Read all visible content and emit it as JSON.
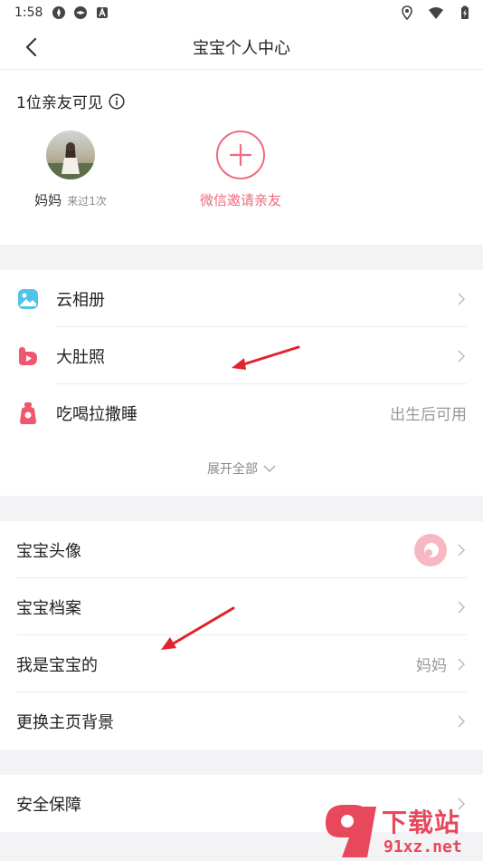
{
  "status_bar": {
    "time": "1:58"
  },
  "nav": {
    "title": "宝宝个人中心"
  },
  "family": {
    "header": "1位亲友可见",
    "member": {
      "name": "妈妈",
      "visit": "来过1次"
    },
    "invite_label": "微信邀请亲友"
  },
  "features": {
    "items": [
      {
        "label": "云相册",
        "icon": "cloud-album-icon",
        "value": ""
      },
      {
        "label": "大肚照",
        "icon": "belly-photo-icon",
        "value": ""
      },
      {
        "label": "吃喝拉撒睡",
        "icon": "daily-record-icon",
        "value": "出生后可用"
      }
    ],
    "expand_label": "展开全部"
  },
  "settings": {
    "items": [
      {
        "label": "宝宝头像",
        "value": ""
      },
      {
        "label": "宝宝档案",
        "value": ""
      },
      {
        "label": "我是宝宝的",
        "value": "妈妈"
      },
      {
        "label": "更换主页背景",
        "value": ""
      }
    ]
  },
  "safety": {
    "label": "安全保障"
  },
  "watermark": {
    "text": "下载站",
    "site": "91xz.net"
  },
  "colors": {
    "accent": "#ef6b7d",
    "arrow": "#e0232e",
    "background": "#f3f3f5"
  }
}
